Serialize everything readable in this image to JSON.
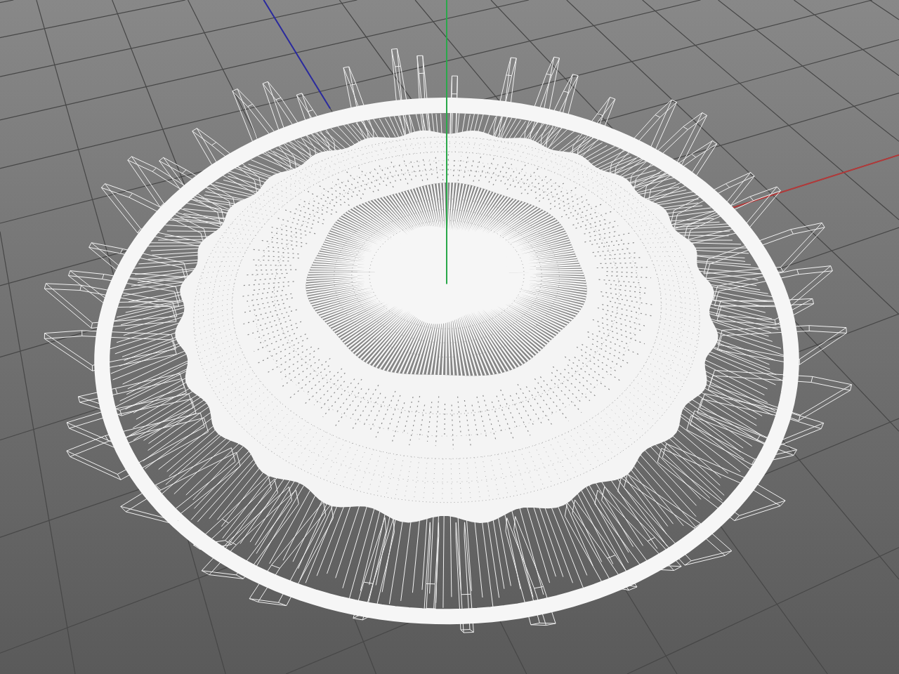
{
  "viewport": {
    "axes": [
      {
        "kind": "x",
        "color": "#b23a3a"
      },
      {
        "kind": "y",
        "color": "#2aa84a"
      },
      {
        "kind": "z",
        "color": "#2b2ba0"
      }
    ],
    "model": {
      "kind": "wireframe"
    }
  }
}
